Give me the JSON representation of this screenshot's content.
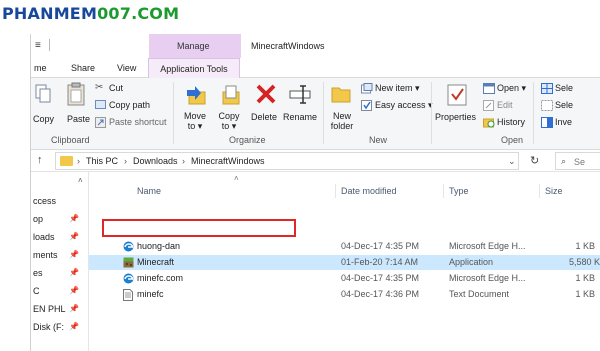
{
  "watermark": {
    "part1": "PHANMEM",
    "part2": "007.COM"
  },
  "window": {
    "title": "MinecraftWindows",
    "context_tab": "Manage"
  },
  "tabs": {
    "home": "me",
    "share": "Share",
    "view": "View",
    "app_tools": "Application Tools"
  },
  "ribbon": {
    "clipboard": {
      "copy": "Copy",
      "paste": "Paste",
      "cut": "Cut",
      "copy_path": "Copy path",
      "paste_shortcut": "Paste shortcut",
      "label": "Clipboard"
    },
    "organize": {
      "move_to": [
        "Move",
        "to ▾"
      ],
      "copy_to": [
        "Copy",
        "to ▾"
      ],
      "delete": "Delete",
      "rename": "Rename",
      "label": "Organize"
    },
    "new": {
      "new_folder": [
        "New",
        "folder"
      ],
      "new_item": "New item ▾",
      "easy_access": "Easy access ▾",
      "label": "New"
    },
    "open": {
      "properties": "Properties",
      "open": "Open ▾",
      "edit": "Edit",
      "history": "History",
      "label": "Open"
    },
    "select": {
      "select_all": "Sele",
      "select_none": "Sele",
      "invert": "Inve"
    }
  },
  "address": {
    "crumbs": [
      "This PC",
      "Downloads",
      "MinecraftWindows"
    ],
    "search_placeholder": "Se"
  },
  "navpane": {
    "items": [
      "ccess",
      "op",
      "loads",
      "ments",
      "es",
      "C",
      "EN PHL",
      "Disk (F:"
    ]
  },
  "columns": {
    "name": "Name",
    "date": "Date modified",
    "type": "Type",
    "size": "Size"
  },
  "files": [
    {
      "name": "huong-dan",
      "date": "04-Dec-17 4:35 PM",
      "type": "Microsoft Edge H...",
      "size": "1 KB",
      "icon": "edge-icon",
      "selected": false
    },
    {
      "name": "Minecraft",
      "date": "01-Feb-20 7:14 AM",
      "type": "Application",
      "size": "5,580 KB",
      "icon": "minecraft-app-icon",
      "selected": true
    },
    {
      "name": "minefc.com",
      "date": "04-Dec-17 4:35 PM",
      "type": "Microsoft Edge H...",
      "size": "1 KB",
      "icon": "edge-icon",
      "selected": false
    },
    {
      "name": "minefc",
      "date": "04-Dec-17 4:36 PM",
      "type": "Text Document",
      "size": "1 KB",
      "icon": "text-document-icon",
      "selected": false
    }
  ],
  "colors": {
    "accent_selection": "#cce8ff",
    "highlight_box": "#e02626",
    "manage_context": "#e8cff2"
  }
}
